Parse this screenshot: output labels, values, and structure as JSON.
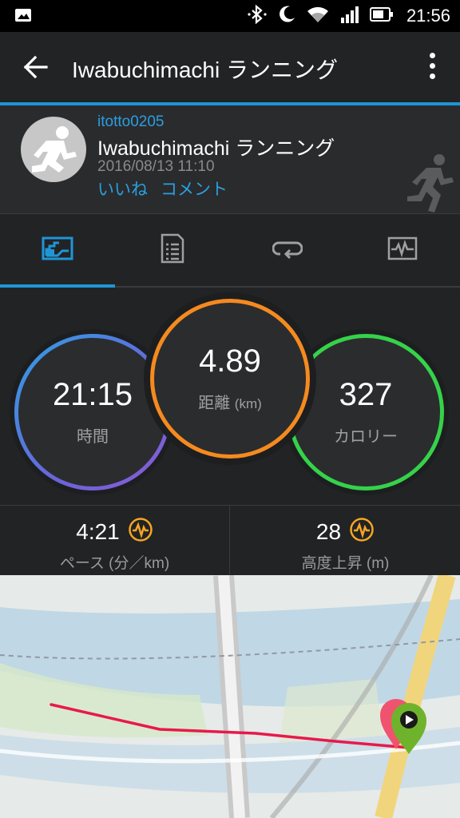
{
  "status_bar": {
    "time": "21:56",
    "icons": [
      "image-icon",
      "bluetooth-icon",
      "moon-icon",
      "wifi-icon",
      "signal-icon",
      "battery-icon"
    ]
  },
  "app_bar": {
    "title": "Iwabuchimachi ランニング"
  },
  "activity": {
    "user": "itotto0205",
    "title": "Iwabuchimachi ランニング",
    "datetime": "2016/08/13 11:10",
    "like_label": "いいね",
    "comment_label": "コメント"
  },
  "tabs": [
    {
      "name": "overview",
      "icon": "overview-chart-icon",
      "active": true
    },
    {
      "name": "details",
      "icon": "details-list-icon",
      "active": false
    },
    {
      "name": "laps",
      "icon": "laps-loop-icon",
      "active": false
    },
    {
      "name": "charts",
      "icon": "heart-chart-icon",
      "active": false
    }
  ],
  "stats": {
    "time": {
      "value": "21:15",
      "label": "時間"
    },
    "distance": {
      "value": "4.89",
      "label": "距離",
      "unit": "(km)"
    },
    "calories": {
      "value": "327",
      "label": "カロリー"
    }
  },
  "metrics": {
    "pace": {
      "value": "4:21",
      "label": "ペース",
      "unit": "(分／km)"
    },
    "elevation": {
      "value": "28",
      "label": "高度上昇",
      "unit": "(m)"
    }
  },
  "colors": {
    "accent": "#1f95d6",
    "time_ring": "#6a64d8",
    "distance_ring": "#f58a1f",
    "calories_ring": "#35d24a",
    "route": "#e8194a",
    "start_pin": "#6fb32c",
    "end_pin": "#f0536e"
  }
}
